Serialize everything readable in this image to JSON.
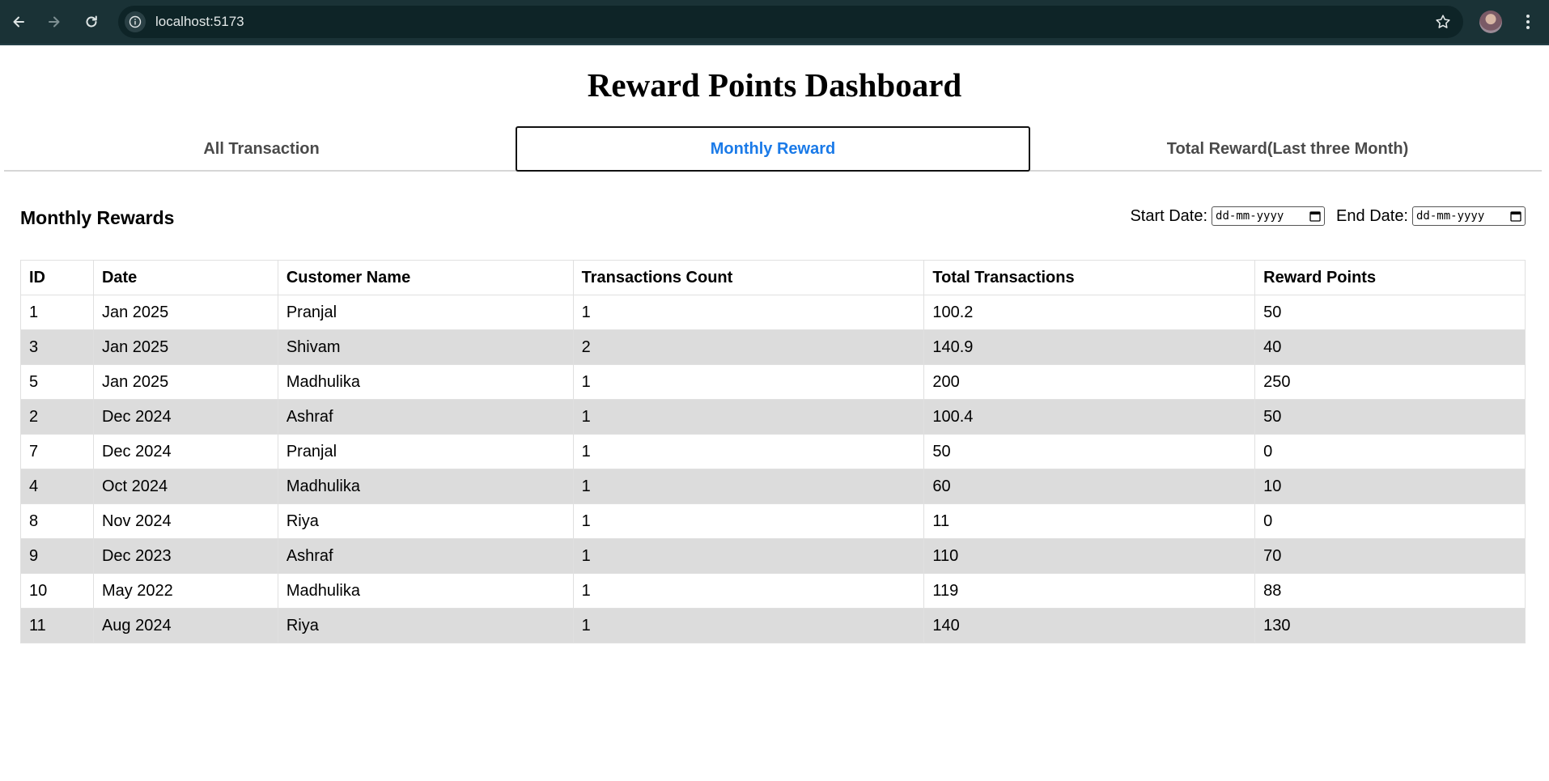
{
  "browser": {
    "url": "localhost:5173",
    "icons": [
      "back-arrow-icon",
      "forward-arrow-icon",
      "reload-icon",
      "site-info-icon",
      "bookmark-star-icon",
      "kebab-menu-icon"
    ]
  },
  "page": {
    "title": "Reward Points Dashboard"
  },
  "tabs": [
    {
      "label": "All Transaction",
      "active": false
    },
    {
      "label": "Monthly Reward",
      "active": true
    },
    {
      "label": "Total Reward(Last three Month)",
      "active": false
    }
  ],
  "section": {
    "title": "Monthly Rewards"
  },
  "filters": {
    "start_label": "Start Date:",
    "start_placeholder": "dd-mm-yyyy",
    "end_label": "End Date:",
    "end_placeholder": "dd-mm-yyyy"
  },
  "table": {
    "columns": [
      "ID",
      "Date",
      "Customer Name",
      "Transactions Count",
      "Total Transactions",
      "Reward Points"
    ],
    "rows": [
      [
        "1",
        "Jan 2025",
        "Pranjal",
        "1",
        "100.2",
        "50"
      ],
      [
        "3",
        "Jan 2025",
        "Shivam",
        "2",
        "140.9",
        "40"
      ],
      [
        "5",
        "Jan 2025",
        "Madhulika",
        "1",
        "200",
        "250"
      ],
      [
        "2",
        "Dec 2024",
        "Ashraf",
        "1",
        "100.4",
        "50"
      ],
      [
        "7",
        "Dec 2024",
        "Pranjal",
        "1",
        "50",
        "0"
      ],
      [
        "4",
        "Oct 2024",
        "Madhulika",
        "1",
        "60",
        "10"
      ],
      [
        "8",
        "Nov 2024",
        "Riya",
        "1",
        "11",
        "0"
      ],
      [
        "9",
        "Dec 2023",
        "Ashraf",
        "1",
        "110",
        "70"
      ],
      [
        "10",
        "May 2022",
        "Madhulika",
        "1",
        "119",
        "88"
      ],
      [
        "11",
        "Aug 2024",
        "Riya",
        "1",
        "140",
        "130"
      ]
    ]
  },
  "colors": {
    "chrome_bg": "#1a3236",
    "omnibox_bg": "#0e2427",
    "active_tab_text": "#1a7ae8",
    "striped_row": "#dcdcdc"
  }
}
